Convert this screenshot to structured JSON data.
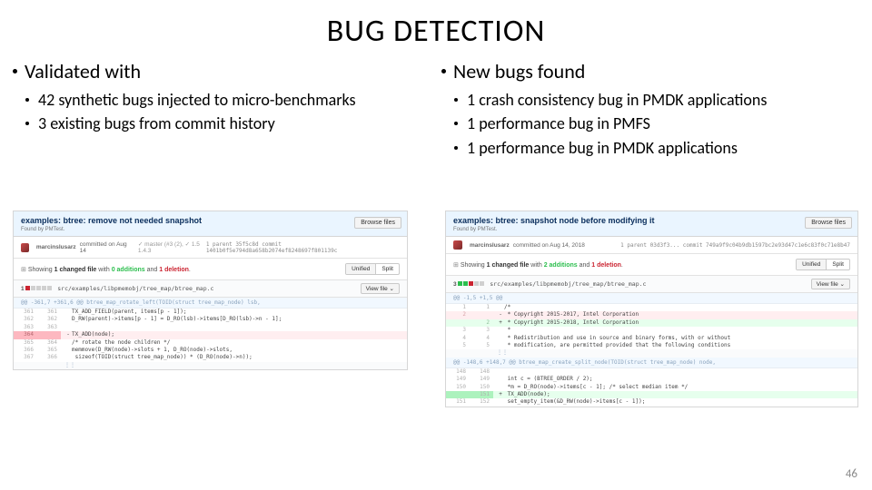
{
  "title": "BUG DETECTION",
  "slide_number": "46",
  "left": {
    "heading": "Validated with",
    "items": [
      "42 synthetic bugs injected to micro-benchmarks",
      "3 existing bugs from commit history"
    ]
  },
  "right": {
    "heading": "New bugs found",
    "items": [
      "1 crash consistency bug in PMDK applications",
      "1 performance bug in PMFS",
      "1 performance bug in PMDK applications"
    ]
  },
  "commit_left": {
    "title": "examples: btree: remove not needed snapshot",
    "subtitle": "Found by PMTest.",
    "browse": "Browse files",
    "author": "marcinslusarz",
    "date": "committed on Aug 14",
    "branch_info": "✓ master (#3 (2), ✓ 1.5  1.4.3",
    "parent_sha": "1 parent 35f5c8d    commit 1401b0f5e794d8a658b2074ef8248697f801139c",
    "changed": {
      "label_prefix": "Showing",
      "files": "1 changed file",
      "label_with": "with",
      "adds": "0 additions",
      "label_and": "and",
      "dels": "1 deletion",
      "unified": "Unified",
      "split": "Split"
    },
    "file": {
      "count": "1",
      "stat_boxes": [
        "r",
        "n",
        "n",
        "n",
        "n"
      ],
      "path": "src/examples/libpmemobj/tree_map/btree_map.c",
      "view": "View file ⌄"
    },
    "hunk": "@@ -361,7 +361,6 @@ btree_map_rotate_left(TOID(struct tree_map_node) lsb,",
    "rows": [
      {
        "cls": "ctx",
        "ln1": "361",
        "ln2": "361",
        "sign": " ",
        "code": "TX_ADD_FIELD(parent, items[p - 1]);"
      },
      {
        "cls": "ctx",
        "ln1": "362",
        "ln2": "362",
        "sign": " ",
        "code": "D_RW(parent)->items[p - 1] = D_RO(lsb)->items[D_RO(lsb)->n - 1];"
      },
      {
        "cls": "ctx",
        "ln1": "363",
        "ln2": "363",
        "sign": " ",
        "code": ""
      },
      {
        "cls": "del-strong",
        "ln1": "364",
        "ln2": "",
        "sign": "-",
        "code": "TX_ADD(node);"
      },
      {
        "cls": "ctx",
        "ln1": "365",
        "ln2": "364",
        "sign": " ",
        "code": "/* rotate the node children */"
      },
      {
        "cls": "ctx",
        "ln1": "366",
        "ln2": "365",
        "sign": " ",
        "code": "memmove(D_RW(node)->slots + 1, D_RO(node)->slots,"
      },
      {
        "cls": "ctx",
        "ln1": "367",
        "ln2": "366",
        "sign": " ",
        "code": "    sizeof(TOID(struct tree_map_node)) * (D_RO(node)->n));"
      }
    ],
    "expand": "⋮⋮"
  },
  "commit_right": {
    "title": "examples: btree: snapshot node before modifying it",
    "subtitle": "Found by PMTest.",
    "browse": "Browse files",
    "author": "marcinslusarz",
    "date": "committed on Aug 14, 2018",
    "parent_sha": "1 parent 03d3f3...    commit 749a9f9c04b9db1597bc2e93d47c1e6c83f0c71e8b47",
    "changed": {
      "label_prefix": "Showing",
      "files": "1 changed file",
      "label_with": "with",
      "adds": "2 additions",
      "label_and": "and",
      "dels": "1 deletion",
      "unified": "Unified",
      "split": "Split"
    },
    "file": {
      "count": "3",
      "stat_boxes": [
        "g",
        "g",
        "r",
        "n",
        "n"
      ],
      "path": "src/examples/libpmemobj/tree_map/btree_map.c",
      "view": "View file ⌄"
    },
    "hunk1": "@@ -1,5 +1,5 @@",
    "rows1": [
      {
        "cls": "ctx",
        "ln1": "1",
        "ln2": "1",
        "sign": " ",
        "code": "/*"
      },
      {
        "cls": "del",
        "ln1": "2",
        "ln2": "",
        "sign": "-",
        "code": " * Copyright 2015-2017, Intel Corporation"
      },
      {
        "cls": "add",
        "ln1": "",
        "ln2": "2",
        "sign": "+",
        "code": " * Copyright 2015-2018, Intel Corporation"
      },
      {
        "cls": "ctx",
        "ln1": "3",
        "ln2": "3",
        "sign": " ",
        "code": " *"
      },
      {
        "cls": "ctx",
        "ln1": "4",
        "ln2": "4",
        "sign": " ",
        "code": " * Redistribution and use in source and binary forms, with or without"
      },
      {
        "cls": "ctx",
        "ln1": "5",
        "ln2": "5",
        "sign": " ",
        "code": " * modification, are permitted provided that the following conditions"
      }
    ],
    "hunk2": "@@ -148,6 +148,7 @@ btree_map_create_split_node(TOID(struct tree_map_node) node,",
    "rows2": [
      {
        "cls": "ctx",
        "ln1": "148",
        "ln2": "148",
        "sign": " ",
        "code": ""
      },
      {
        "cls": "ctx",
        "ln1": "149",
        "ln2": "149",
        "sign": " ",
        "code": "    int c = (BTREE_ORDER / 2);"
      },
      {
        "cls": "ctx",
        "ln1": "150",
        "ln2": "150",
        "sign": " ",
        "code": "    *m = D_RO(node)->items[c - 1]; /* select median item */"
      },
      {
        "cls": "add-strong",
        "ln1": "",
        "ln2": "151",
        "sign": "+",
        "code": "    TX_ADD(node);"
      },
      {
        "cls": "ctx",
        "ln1": "151",
        "ln2": "152",
        "sign": " ",
        "code": "    set_empty_item(&D_RW(node)->items[c - 1]);"
      }
    ],
    "expand": "⋮⋮"
  }
}
